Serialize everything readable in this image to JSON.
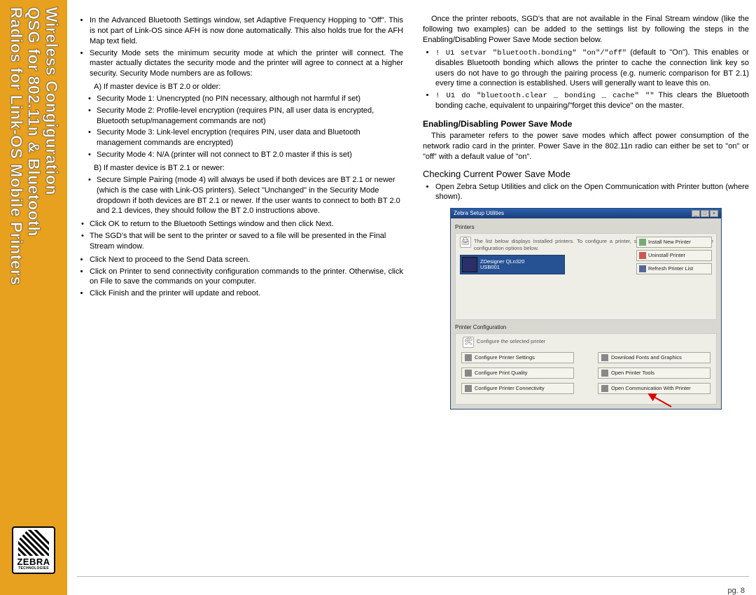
{
  "sidebar": {
    "line1": "Wireless Congiguration",
    "line2": "QSG for 802.11n & Bluetooth",
    "line3": "Radios for Link-OS Mobile Printers",
    "logo_name": "ZEBRA",
    "logo_sub": "TECHNOLOGIES"
  },
  "left": {
    "b1": "In the Advanced Bluetooth Settings window, set Adaptive Frequency Hopping to \"Off\". This is not part of Link-OS since AFH is now done automatically. This also holds true for the AFH Map text field.",
    "b2": "Security Mode sets the minimum security mode at which the printer will connect. The master actually dictates the security mode and the printer will agree to connect at a higher security. Security Mode numbers are as follows:",
    "A": "A) If master device is BT 2.0 or older:",
    "A1": "Security Mode 1: Unencrypted (no PIN necessary, although not harmful if set)",
    "A2": "Security Mode 2: Profile-level encryption (requires PIN, all user data is encrypted, Bluetooth setup/management commands are not)",
    "A3": "Security Mode 3: Link-level encryption (requires PIN, user data and Bluetooth management commands are encrypted)",
    "A4": "Security Mode 4: N/A (printer will not connect to BT 2.0 master if this is set)",
    "B": "B) If master device is BT 2.1 or newer:",
    "B1": "Secure Simple Pairing (mode 4) will always be used if both devices are BT 2.1 or newer (which is the case with Link-OS printers). Select \"Unchanged\" in the Security Mode dropdown if both devices are BT 2.1 or newer. If the user wants to connect to both BT 2.0 and 2.1 devices, they should follow the BT 2.0 instructions above.",
    "s1": "Click OK to return to the Bluetooth Settings window and then click Next.",
    "s2": "The SGD's that will be sent to the printer or saved to a file will be presented in the Final Stream window.",
    "b3": "Click Next to proceed to the Send Data screen.",
    "b4": "Click on Printer to send connectivity configuration commands to the printer. Otherwise, click on File to save the commands on your computer.",
    "b5": "Click Finish and the printer will update and reboot."
  },
  "right": {
    "intro": "Once the printer reboots, SGD's that are not available in the Final Stream window (like the following two examples) can be added to the settings list by following the steps in the Enabling/Disabling Power Save Mode section below.",
    "cmd1_code": "! U1 setvar \"bluetooth.bonding\" \"on\"/\"off\"",
    "cmd1_text": " (default to \"On\"). This enables or disables Bluetooth bonding which allows the printer to cache the connection link key so users do not have to go through the pairing process (e.g. numeric comparison for BT 2.1) every time a connection is established. Users will generally want to leave this on.",
    "cmd2_code": "! U1 do \"bluetooth.clear _ bonding _ cache\" \"\"",
    "cmd2_text": " This clears the Bluetooth bonding cache, equivalent to unpairing/\"forget this device\" on the master.",
    "h3": "Enabling/Disabling Power Save Mode",
    "p1": "This parameter refers to the power save modes which affect power consumption of the network radio card in the printer. Power Save in the 802.11n radio can either be set to \"on\" or \"off\" with a default value of \"on\".",
    "h4": "Checking Current Power Save Mode",
    "p2": "Open Zebra Setup Utilities and click on the Open Communication with Printer button (where shown).",
    "scr": {
      "title": "Zebra Setup Utilities",
      "printers_label": "Printers",
      "hint": "The list below displays installed printers. To configure a printer, select it and choose one of the configuration options below.",
      "printer_name": "ZDesigner QLn320",
      "printer_port": "USB001",
      "btn_install": "Install New Printer",
      "btn_uninstall": "Uninstall Printer",
      "btn_refresh": "Refresh Printer List",
      "pc_label": "Printer Configuration",
      "pc_hint": "Configure the selected printer",
      "btn_cfg_settings": "Configure Printer Settings",
      "btn_dl_fonts": "Download Fonts and Graphics",
      "btn_cfg_quality": "Configure Print Quality",
      "btn_open_tools": "Open Printer Tools",
      "btn_cfg_conn": "Configure Printer Connectivity",
      "btn_open_comm": "Open Communication With Printer"
    }
  },
  "pagenum": "pg. 8"
}
